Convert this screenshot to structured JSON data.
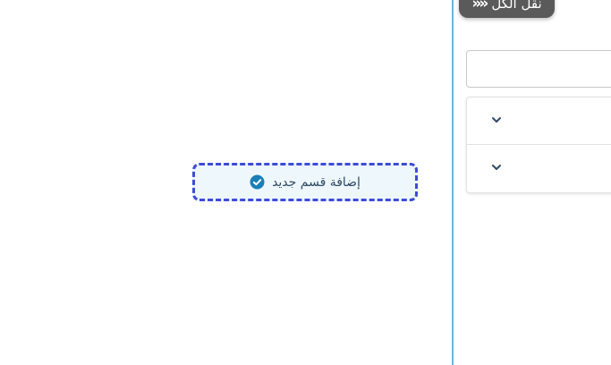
{
  "canvas": {
    "add_section_label": "إضافة قسم جديد",
    "add_section_icon": "check-circle-icon"
  },
  "panel": {
    "collapse_all_label": "نقل الكل",
    "collapse_all_icon": "double-chevron-left-icon",
    "search": {
      "value": "",
      "placeholder": ""
    },
    "accordion_items": [
      {
        "icon": "chevron-down-icon"
      },
      {
        "icon": "chevron-down-icon"
      }
    ]
  },
  "colors": {
    "accent_border": "#3d4bd8",
    "button_bg": "#eef7fc",
    "check_icon": "#1a7fb8",
    "divider": "#6fb6dc",
    "collapse_bg": "#5a5a5a",
    "chevron": "#2f4a66"
  }
}
